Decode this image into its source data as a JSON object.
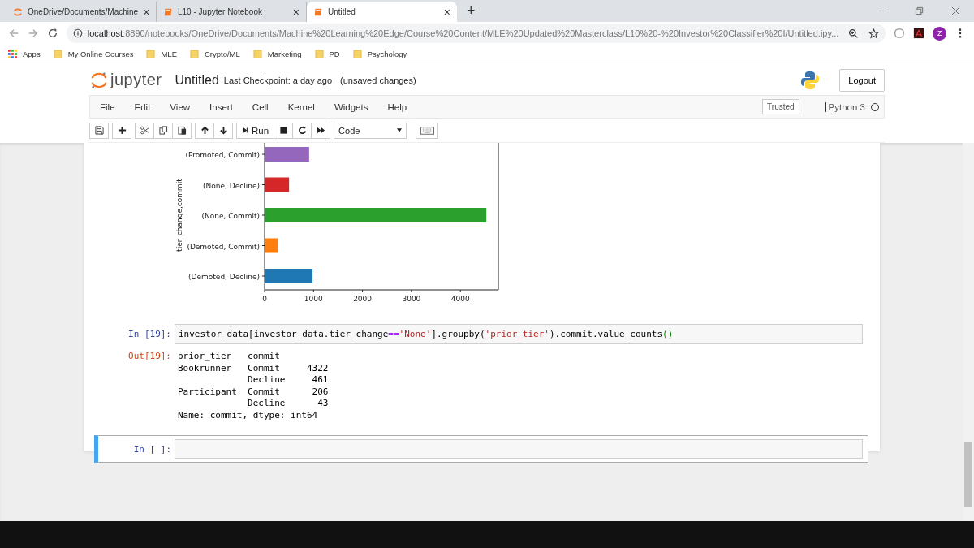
{
  "browser": {
    "tabs": [
      {
        "title": "OneDrive/Documents/Machine",
        "kind": "jupyter",
        "selected": false
      },
      {
        "title": "L10 - Jupyter Notebook",
        "kind": "notebook",
        "selected": false
      },
      {
        "title": "Untitled",
        "kind": "notebook",
        "selected": true
      }
    ],
    "new_tab": "+",
    "tab_close": "×",
    "url": {
      "host": "localhost",
      "rest": ":8890/notebooks/OneDrive/Documents/Machine%20Learning%20Edge/Course%20Content/MLE%20Updated%20Masterclass/L10%20-%20Investor%20Classifier%20I/Untitled.ipy..."
    },
    "profile": "Z",
    "bookmarks": [
      {
        "label": "Apps",
        "kind": "apps"
      },
      {
        "label": "My Online Courses",
        "kind": "folder"
      },
      {
        "label": "MLE",
        "kind": "folder"
      },
      {
        "label": "Crypto/ML",
        "kind": "folder"
      },
      {
        "label": "Marketing",
        "kind": "folder"
      },
      {
        "label": "PD",
        "kind": "folder"
      },
      {
        "label": "Psychology",
        "kind": "folder"
      }
    ]
  },
  "header": {
    "logo_text": "jupyter",
    "notebook_name": "Untitled",
    "checkpoint": "Last Checkpoint: a day ago",
    "autosave": "(unsaved changes)",
    "logout": "Logout"
  },
  "menu": [
    "File",
    "Edit",
    "View",
    "Insert",
    "Cell",
    "Kernel",
    "Widgets",
    "Help"
  ],
  "trusted": "Trusted",
  "kernel": {
    "name": "Python 3",
    "busy": false
  },
  "toolbar": {
    "run": "Run",
    "cell_type": "Code"
  },
  "chart": {
    "chart_data": {
      "type": "bar",
      "orientation": "horizontal",
      "ylabel": "tier_change,commit",
      "categories": [
        "(Promoted, Commit)",
        "(None, Decline)",
        "(None, Commit)",
        "(Demoted, Commit)",
        "(Demoted, Decline)"
      ],
      "colors": [
        "#9467bd",
        "#d62728",
        "#2ca02c",
        "#ff7f0e",
        "#1f77b4"
      ],
      "values": [
        910,
        500,
        4530,
        270,
        980
      ],
      "xlim": [
        0,
        4776
      ],
      "xticks": [
        0,
        1000,
        2000,
        3000,
        4000
      ]
    }
  },
  "cells": [
    {
      "kind": "code",
      "prompt": "In [19]:",
      "tokens": [
        {
          "text": "investor_data[investor_data.tier_change",
          "kind": "plain"
        },
        {
          "text": "==",
          "kind": "op"
        },
        {
          "text": "'None'",
          "kind": "str"
        },
        {
          "text": "].groupby(",
          "kind": "plain"
        },
        {
          "text": "'prior_tier'",
          "kind": "str"
        },
        {
          "text": ").commit.value_counts",
          "kind": "plain"
        },
        {
          "text": "()",
          "kind": "match"
        }
      ],
      "out_prompt": "Out[19]:",
      "output": [
        "prior_tier   commit",
        "Bookrunner   Commit     4322",
        "             Decline     461",
        "Participant  Commit      206",
        "             Decline      43",
        "Name: commit, dtype: int64"
      ],
      "selected": false
    },
    {
      "kind": "code",
      "prompt": "In [ ]:",
      "selected": true
    }
  ]
}
